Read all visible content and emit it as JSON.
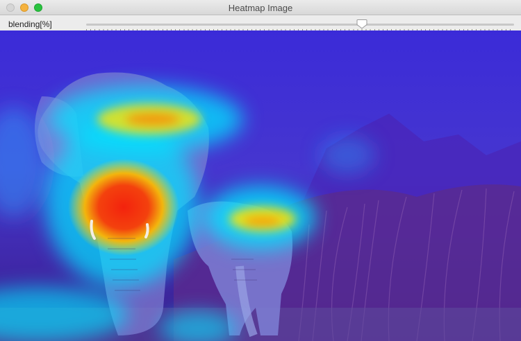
{
  "window": {
    "title": "Heatmap Image",
    "controls": [
      "close-button",
      "minimize-button",
      "zoom-button"
    ]
  },
  "slider": {
    "label": "blending[%]",
    "value_fraction": 0.645
  },
  "image": {
    "content": "heatmap overlay on elephants in tall grass",
    "colormap": [
      "#2a1bff",
      "#00e5ff",
      "#ffe600",
      "#ff1a00"
    ]
  }
}
